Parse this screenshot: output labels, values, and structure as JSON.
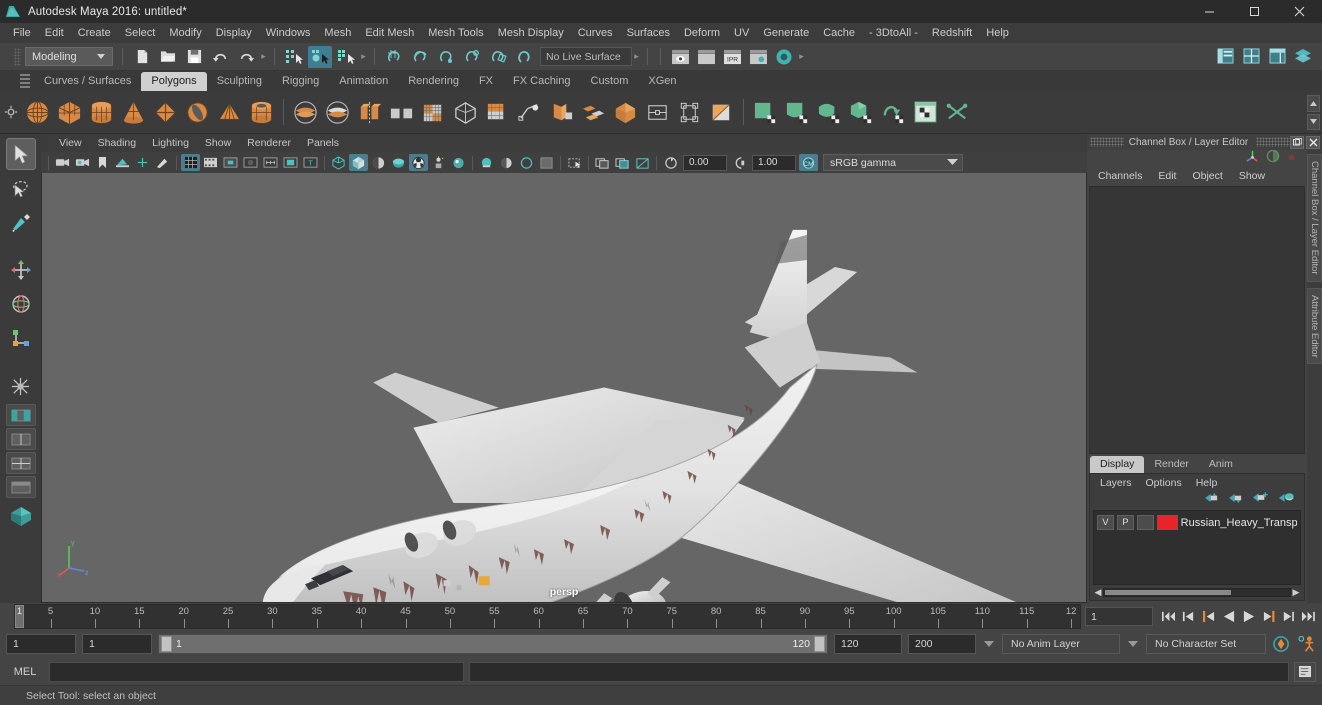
{
  "window": {
    "title": "Autodesk Maya 2016: untitled*",
    "logo_icon": "maya-logo-icon",
    "minimize_icon": "minimize-icon",
    "maximize_icon": "maximize-icon",
    "close_icon": "close-icon"
  },
  "menubar": {
    "items": [
      "File",
      "Edit",
      "Create",
      "Select",
      "Modify",
      "Display",
      "Windows",
      "Mesh",
      "Edit Mesh",
      "Mesh Tools",
      "Mesh Display",
      "Curves",
      "Surfaces",
      "Deform",
      "UV",
      "Generate",
      "Cache",
      "- 3DtoAll -",
      "Redshift",
      "Help"
    ]
  },
  "statusrow": {
    "mode": "Modeling",
    "live_surface": "No Live Surface",
    "icons": [
      "new-scene-icon",
      "open-scene-icon",
      "save-scene-icon",
      "undo-icon",
      "redo-icon",
      "select-by-hierarchy-icon",
      "select-by-object-icon",
      "select-by-component-icon",
      "snap-grid-icon",
      "snap-curve-icon",
      "snap-point-icon",
      "snap-projected-icon",
      "snap-view-plane-icon",
      "make-live-icon",
      "render-view-icon",
      "render-current-frame-icon",
      "ipr-render-icon",
      "render-settings-icon",
      "hypershade-icon"
    ],
    "right_icons": [
      "show-hide-ui-icon",
      "editor-layout-icon",
      "expand-panel-icon",
      "layers-icon"
    ]
  },
  "shelf": {
    "tabs": [
      {
        "label": "Curves / Surfaces",
        "active": false
      },
      {
        "label": "Polygons",
        "active": true
      },
      {
        "label": "Sculpting",
        "active": false
      },
      {
        "label": "Rigging",
        "active": false
      },
      {
        "label": "Animation",
        "active": false
      },
      {
        "label": "Rendering",
        "active": false
      },
      {
        "label": "FX",
        "active": false
      },
      {
        "label": "FX Caching",
        "active": false
      },
      {
        "label": "Custom",
        "active": false
      },
      {
        "label": "XGen",
        "active": false
      }
    ],
    "icons": [
      "poly-sphere-icon",
      "poly-cube-icon",
      "poly-cylinder-icon",
      "poly-cone-icon",
      "poly-plane-icon",
      "poly-torus-icon",
      "poly-pyramid-icon",
      "poly-pipe-icon",
      "poly-boolean-union-icon",
      "poly-boolean-difference-icon",
      "poly-combine-icon",
      "poly-separate-icon",
      "poly-smooth-icon",
      "poly-sculpt-icon",
      "poly-extrude-icon",
      "poly-bevel-icon",
      "poly-bridge-icon",
      "poly-append-icon",
      "poly-merge-icon",
      "poly-split-icon",
      "poly-multicut-icon",
      "poly-quad-draw-icon",
      "uv-planar-icon",
      "uv-cylindrical-icon",
      "uv-spherical-icon",
      "uv-automatic-icon",
      "uv-unfold-icon",
      "uv-editor-icon",
      "uv-cut-sew-icon"
    ]
  },
  "toolbox": {
    "tools": [
      "select-tool-icon",
      "lasso-select-tool-icon",
      "paint-select-tool-icon",
      "move-tool-icon",
      "rotate-tool-icon",
      "scale-tool-icon",
      "last-tool-icon",
      "show-manipulator-icon"
    ],
    "layout_presets": [
      "single-view-layout-icon",
      "two-pane-layout-icon",
      "four-pane-layout-icon",
      "persp-outliner-layout-icon",
      "hypershade-layout-icon"
    ]
  },
  "viewport": {
    "panel_menus": [
      "View",
      "Shading",
      "Lighting",
      "Show",
      "Renderer",
      "Panels"
    ],
    "camera_label": "persp",
    "toolbar": {
      "exposure_value": "0.00",
      "gamma_value": "1.00",
      "color_space": "sRGB gamma",
      "icons": [
        "select-camera-icon",
        "camera-attributes-icon",
        "bookmark-icon",
        "image-plane-icon",
        "two-d-pan-zoom-icon",
        "grease-pencil-icon",
        "grid-icon",
        "film-gate-icon",
        "resolution-gate-icon",
        "gate-mask-icon",
        "film-origin-icon",
        "safe-action-icon",
        "title-safe-icon",
        "wireframe-icon",
        "smooth-shade-all-icon",
        "smooth-shade-selected-icon",
        "flat-shade-icon",
        "wireframe-on-shaded-icon",
        "xray-icon",
        "xray-joints-icon",
        "lights-default-icon",
        "lights-all-icon",
        "shadows-icon",
        "screen-space-ao-icon",
        "motion-blur-icon",
        "multisample-icon",
        "depth-peel-icon",
        "exposure-icon",
        "gamma-icon",
        "color-management-icon"
      ]
    },
    "axis_gizmo": {
      "x_label": "x",
      "y_label": "y",
      "z_label": "z"
    }
  },
  "channel_box": {
    "panel_title": "Channel Box / Layer Editor",
    "undock_icon": "undock-icon",
    "close_icon": "close-icon",
    "menus": [
      "Channels",
      "Edit",
      "Object",
      "Show"
    ],
    "side_tabs": [
      "Channel Box / Layer Editor",
      "Attribute Editor"
    ],
    "tool_icons": [
      "manipulator-icon",
      "sphere-icon",
      "red-dot-icon"
    ]
  },
  "layer_editor": {
    "tabs": [
      {
        "label": "Display",
        "active": true
      },
      {
        "label": "Render",
        "active": false
      },
      {
        "label": "Anim",
        "active": false
      }
    ],
    "menus": [
      "Layers",
      "Options",
      "Help"
    ],
    "buttons": [
      "move-layer-up-icon",
      "move-layer-down-icon",
      "new-layer-icon",
      "new-layer-from-selected-icon"
    ],
    "layers": [
      {
        "visibility": "V",
        "playback": "P",
        "type": "",
        "color": "#e8232a",
        "name": "Russian_Heavy_Transp"
      }
    ]
  },
  "timeline": {
    "current_frame": "1",
    "current_frame_field": "1",
    "ticks": [
      {
        "label": "5",
        "frame": 5
      },
      {
        "label": "10",
        "frame": 10
      },
      {
        "label": "15",
        "frame": 15
      },
      {
        "label": "20",
        "frame": 20
      },
      {
        "label": "25",
        "frame": 25
      },
      {
        "label": "30",
        "frame": 30
      },
      {
        "label": "35",
        "frame": 35
      },
      {
        "label": "40",
        "frame": 40
      },
      {
        "label": "45",
        "frame": 45
      },
      {
        "label": "50",
        "frame": 50
      },
      {
        "label": "55",
        "frame": 55
      },
      {
        "label": "60",
        "frame": 60
      },
      {
        "label": "65",
        "frame": 65
      },
      {
        "label": "70",
        "frame": 70
      },
      {
        "label": "75",
        "frame": 75
      },
      {
        "label": "80",
        "frame": 80
      },
      {
        "label": "85",
        "frame": 85
      },
      {
        "label": "90",
        "frame": 90
      },
      {
        "label": "95",
        "frame": 95
      },
      {
        "label": "100",
        "frame": 100
      },
      {
        "label": "105",
        "frame": 105
      },
      {
        "label": "110",
        "frame": 110
      },
      {
        "label": "115",
        "frame": 115
      },
      {
        "label": "12",
        "frame": 120
      }
    ],
    "range_start": 1,
    "range_end": 121,
    "playback_buttons": [
      "go-to-start-icon",
      "step-back-keyframe-icon",
      "step-back-frame-icon",
      "play-backwards-icon",
      "play-forwards-icon",
      "step-forward-frame-icon",
      "step-forward-keyframe-icon",
      "go-to-end-icon"
    ]
  },
  "range_row": {
    "anim_start": "1",
    "range_start": "1",
    "slider_start_label": "1",
    "slider_end_label": "120",
    "range_end": "120",
    "anim_end": "200",
    "anim_layer": "No Anim Layer",
    "character_set": "No Character Set",
    "auto_key_icon": "auto-keyframe-icon",
    "anim_prefs_icon": "animation-preferences-icon"
  },
  "command_line": {
    "language_label": "MEL",
    "input_value": "",
    "output_value": "",
    "script_editor_icon": "script-editor-icon"
  },
  "statusbar": {
    "message": "Select Tool: select an object"
  }
}
